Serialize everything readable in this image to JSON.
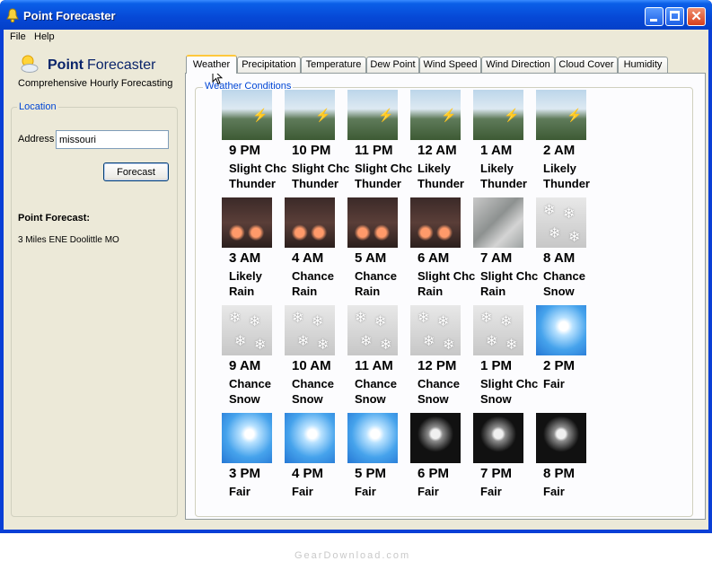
{
  "window": {
    "title": "Point Forecaster"
  },
  "menu": {
    "file": "File",
    "help": "Help"
  },
  "app": {
    "name_bold": "Point",
    "name_rest": "Forecaster",
    "subtitle": "Comprehensive Hourly Forecasting"
  },
  "location": {
    "group_label": "Location",
    "address_label": "Address",
    "address_value": "missouri",
    "forecast_button": "Forecast"
  },
  "point_forecast": {
    "title": "Point Forecast:",
    "location": "3 Miles ENE Doolittle MO"
  },
  "tabs": [
    "Weather",
    "Precipitation",
    "Temperature",
    "Dew Point",
    "Wind Speed",
    "Wind Direction",
    "Cloud Cover",
    "Humidity"
  ],
  "active_tab": "Weather",
  "weather_group_label": "Weather Conditions",
  "forecast": [
    {
      "time": "9 PM",
      "line1": "Slight Chc",
      "line2": "Thunder",
      "icon": "thunder-icon"
    },
    {
      "time": "10 PM",
      "line1": "Slight Chc",
      "line2": "Thunder",
      "icon": "thunder-icon"
    },
    {
      "time": "11 PM",
      "line1": "Slight Chc",
      "line2": "Thunder",
      "icon": "thunder-icon"
    },
    {
      "time": "12 AM",
      "line1": "Likely",
      "line2": "Thunder",
      "icon": "thunder-icon"
    },
    {
      "time": "1 AM",
      "line1": "Likely",
      "line2": "Thunder",
      "icon": "thunder-icon"
    },
    {
      "time": "2 AM",
      "line1": "Likely",
      "line2": "Thunder",
      "icon": "thunder-icon"
    },
    {
      "time": "3 AM",
      "line1": "Likely",
      "line2": "Rain",
      "icon": "rain-icon"
    },
    {
      "time": "4 AM",
      "line1": "Chance",
      "line2": "Rain",
      "icon": "rain-icon"
    },
    {
      "time": "5 AM",
      "line1": "Chance",
      "line2": "Rain",
      "icon": "rain-icon"
    },
    {
      "time": "6 AM",
      "line1": "Slight Chc",
      "line2": "Rain",
      "icon": "rain-icon"
    },
    {
      "time": "7 AM",
      "line1": "Slight Chc",
      "line2": "Rain",
      "icon": "light-rain-icon"
    },
    {
      "time": "8 AM",
      "line1": "Chance",
      "line2": "Snow",
      "icon": "snow-icon"
    },
    {
      "time": "9 AM",
      "line1": "Chance",
      "line2": "Snow",
      "icon": "snow-icon"
    },
    {
      "time": "10 AM",
      "line1": "Chance",
      "line2": "Snow",
      "icon": "snow-icon"
    },
    {
      "time": "11 AM",
      "line1": "Chance",
      "line2": "Snow",
      "icon": "snow-icon"
    },
    {
      "time": "12 PM",
      "line1": "Chance",
      "line2": "Snow",
      "icon": "snow-icon"
    },
    {
      "time": "1 PM",
      "line1": "Slight Chc",
      "line2": "Snow",
      "icon": "snow-icon"
    },
    {
      "time": "2 PM",
      "line1": "Fair",
      "line2": "",
      "icon": "sun-icon"
    },
    {
      "time": "3 PM",
      "line1": "Fair",
      "line2": "",
      "icon": "sun-icon"
    },
    {
      "time": "4 PM",
      "line1": "Fair",
      "line2": "",
      "icon": "sun-icon"
    },
    {
      "time": "5 PM",
      "line1": "Fair",
      "line2": "",
      "icon": "sun-icon"
    },
    {
      "time": "6 PM",
      "line1": "Fair",
      "line2": "",
      "icon": "moon-icon"
    },
    {
      "time": "7 PM",
      "line1": "Fair",
      "line2": "",
      "icon": "moon-icon"
    },
    {
      "time": "8 PM",
      "line1": "Fair",
      "line2": "",
      "icon": "moon-icon"
    }
  ],
  "watermark": "GearDownload.com",
  "colors": {
    "titlebar": "#0648d6",
    "window_bg": "#ece9d8",
    "group_label": "#0046d5",
    "active_tab_accent": "#ffc83c"
  }
}
